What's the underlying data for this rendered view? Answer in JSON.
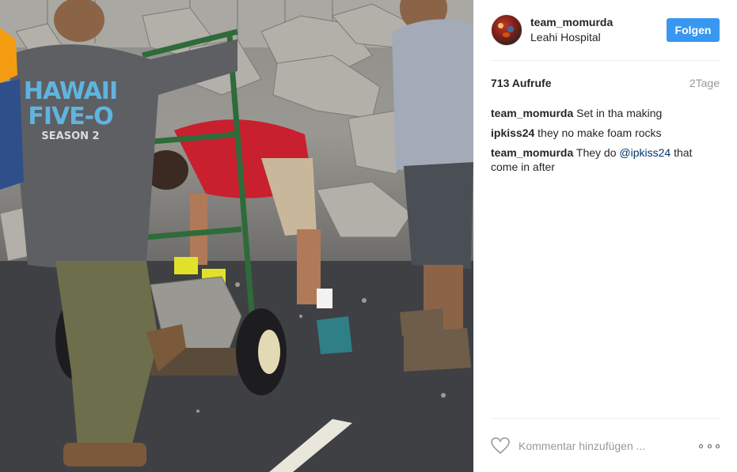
{
  "post": {
    "username": "team_momurda",
    "location": "Leahi Hospital",
    "follow_label": "Folgen",
    "views": "713 Aufrufe",
    "age": "2Tage"
  },
  "comments": [
    {
      "user": "team_momurda",
      "text": "Set in tha making"
    },
    {
      "user": "ipkiss24",
      "text": "they no make foam rocks"
    },
    {
      "user": "team_momurda",
      "text_before": "They do ",
      "mention": "@ipkiss24",
      "text_after": " that come in after"
    }
  ],
  "footer": {
    "comment_placeholder": "Kommentar hinzufügen ..."
  },
  "media": {
    "shirt_text_line1": "HAWAII",
    "shirt_text_line2": "FIVE-O",
    "shirt_text_line3": "SEASON 2"
  },
  "colors": {
    "follow_button": "#3897f0",
    "mention": "#003569",
    "muted": "#999999"
  },
  "icons": [
    "heart-icon",
    "more-options-icon"
  ]
}
